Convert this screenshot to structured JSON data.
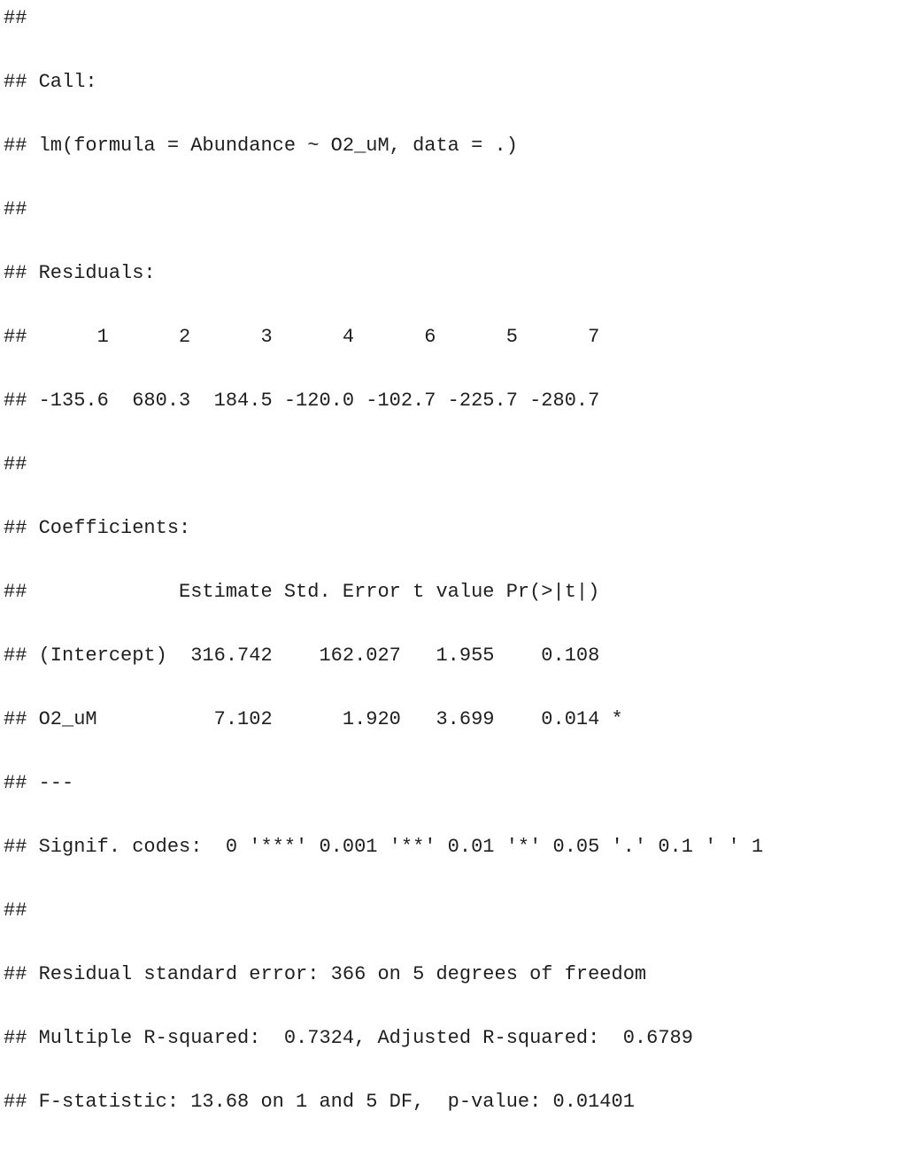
{
  "console": {
    "lines": [
      "##",
      "## Call:",
      "## lm(formula = Abundance ~ O2_uM, data = .)",
      "##",
      "## Residuals:",
      "##      1      2      3      4      6      5      7",
      "## -135.6  680.3  184.5 -120.0 -102.7 -225.7 -280.7",
      "##",
      "## Coefficients:",
      "##             Estimate Std. Error t value Pr(>|t|)",
      "## (Intercept)  316.742    162.027   1.955    0.108",
      "## O2_uM          7.102      1.920   3.699    0.014 *",
      "## ---",
      "## Signif. codes:  0 '***' 0.001 '**' 0.01 '*' 0.05 '.' 0.1 ' ' 1",
      "##",
      "## Residual standard error: 366 on 5 degrees of freedom",
      "## Multiple R-squared:  0.7324, Adjusted R-squared:  0.6789",
      "## F-statistic: 13.68 on 1 and 5 DF,  p-value: 0.01401"
    ]
  }
}
